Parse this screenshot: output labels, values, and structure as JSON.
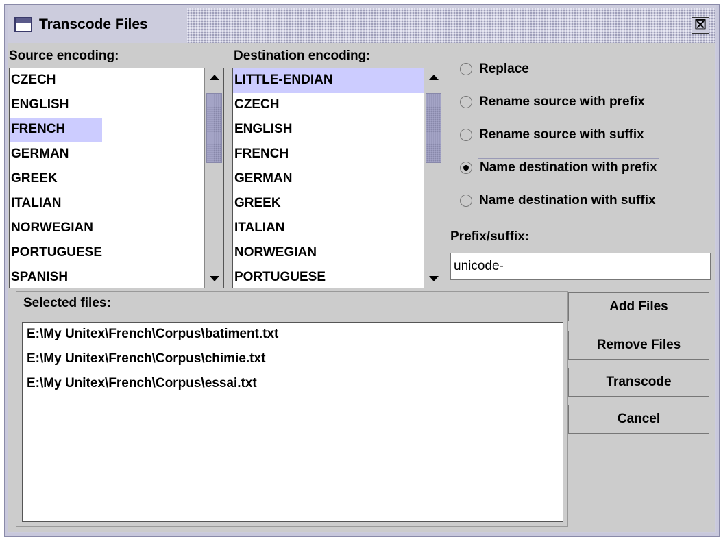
{
  "window": {
    "title": "Transcode Files",
    "close_glyph": "☒"
  },
  "source": {
    "label": "Source encoding:",
    "items": [
      "CZECH",
      "ENGLISH",
      "FRENCH",
      "GERMAN",
      "GREEK",
      "ITALIAN",
      "NORWEGIAN",
      "PORTUGUESE",
      "SPANISH"
    ],
    "selected": "FRENCH"
  },
  "destination": {
    "label": "Destination encoding:",
    "items": [
      "LITTLE-ENDIAN",
      "CZECH",
      "ENGLISH",
      "FRENCH",
      "GERMAN",
      "GREEK",
      "ITALIAN",
      "NORWEGIAN",
      "PORTUGUESE"
    ],
    "selected": "LITTLE-ENDIAN"
  },
  "options": {
    "radios": [
      {
        "label": "Replace",
        "checked": false
      },
      {
        "label": "Rename source with prefix",
        "checked": false
      },
      {
        "label": "Rename source with suffix",
        "checked": false
      },
      {
        "label": "Name destination with prefix",
        "checked": true
      },
      {
        "label": "Name destination with suffix",
        "checked": false
      }
    ],
    "prefix_label": "Prefix/suffix:",
    "prefix_value": "unicode-"
  },
  "files": {
    "label": "Selected files:",
    "items": [
      "E:\\My Unitex\\French\\Corpus\\batiment.txt",
      "E:\\My Unitex\\French\\Corpus\\chimie.txt",
      "E:\\My Unitex\\French\\Corpus\\essai.txt"
    ]
  },
  "buttons": {
    "add": "Add Files",
    "remove": "Remove Files",
    "transcode": "Transcode",
    "cancel": "Cancel"
  },
  "icons": {
    "window": "window-icon",
    "close": "close-icon",
    "scroll_up": "arrow-up-icon",
    "scroll_down": "arrow-down-icon"
  },
  "colors": {
    "selection": "#ccccff",
    "title_bg": "#ccccdd",
    "panel_bg": "#cccccc"
  }
}
